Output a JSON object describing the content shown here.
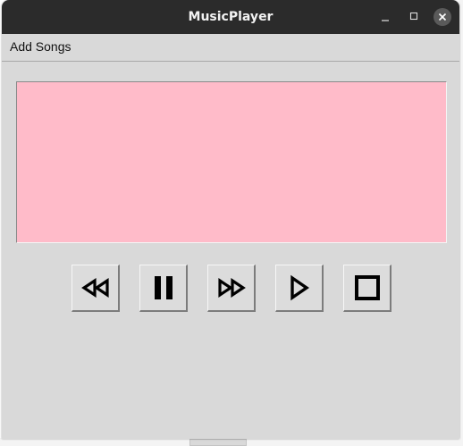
{
  "window": {
    "title": "MusicPlayer",
    "controls": [
      "minimize-icon",
      "maximize-icon",
      "close-icon"
    ]
  },
  "menubar": {
    "items": [
      {
        "label": "Add Songs"
      }
    ]
  },
  "display": {
    "background": "#ffbbc9"
  },
  "playback_controls": [
    {
      "name": "rewind",
      "icon": "rewind-icon"
    },
    {
      "name": "pause",
      "icon": "pause-icon"
    },
    {
      "name": "fast-forward",
      "icon": "fast-forward-icon"
    },
    {
      "name": "play",
      "icon": "play-icon"
    },
    {
      "name": "stop",
      "icon": "stop-icon"
    }
  ],
  "colors": {
    "titlebar": "#2b2b2b",
    "window_bg": "#d9d9d9",
    "display_bg": "#ffbbc9",
    "icon": "#000000"
  }
}
